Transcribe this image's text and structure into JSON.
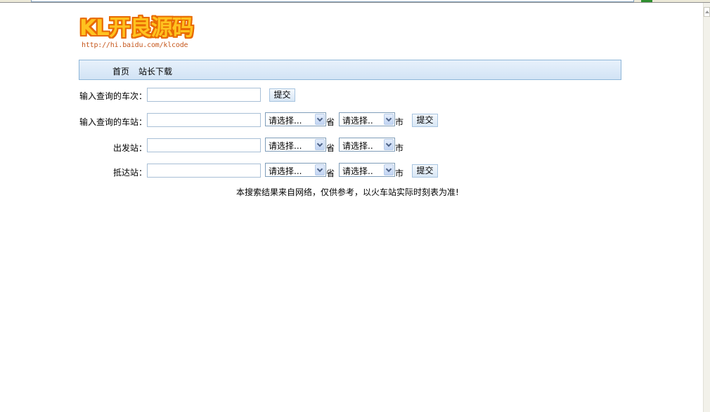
{
  "logo": {
    "text": "KL开良源码",
    "url": "http://hi.baidu.com/klcode"
  },
  "nav": {
    "items": [
      "首页",
      "站长下载"
    ]
  },
  "form": {
    "train_label": "输入查询的车次：",
    "station_label": "输入查询的车站：",
    "departure_label": "出发站：",
    "arrival_label": "抵达站：",
    "submit_label": "提交",
    "province_placeholder": "请选择...",
    "city_placeholder": "请选择..",
    "province_unit": "省",
    "city_unit": "市"
  },
  "notice": "本搜索结果来自网络，仅供参考，以火车站实际时刻表为准!"
}
